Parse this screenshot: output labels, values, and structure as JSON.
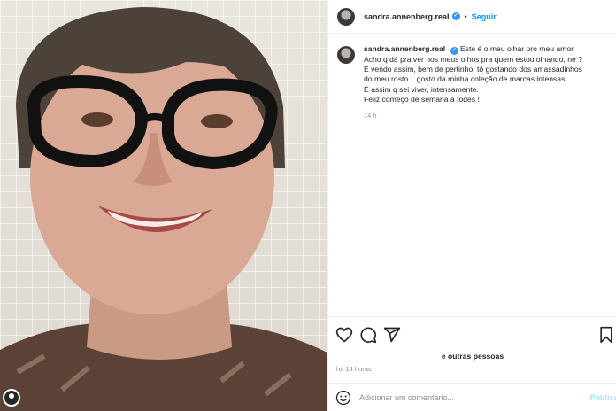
{
  "post": {
    "username": "sandra.annenberg.real",
    "follow_label": "Seguir",
    "separator": "•",
    "verified_mark": "✓"
  },
  "caption": {
    "lines": [
      "Este é o meu olhar pro meu amor.",
      "Acho q dá pra ver nos meus olhos pra quem estou olhando, né ?",
      "E vendo assim, bem de pertinho, tô gostando dos amassadinhos",
      "do meu rosto... gosto da minha coleção de marcas intensas.",
      "É assim q sei viver, intensamente.",
      "Feliz começo de semana a todes !"
    ],
    "time": "14 h"
  },
  "actions": {
    "like_icon": "heart-icon",
    "comment_icon": "comment-icon",
    "share_icon": "share-icon",
    "save_icon": "bookmark-icon"
  },
  "likes_text": "e outras pessoas",
  "timestamp": "há 14 horas",
  "comment_box": {
    "placeholder": "Adicionar um comentário...",
    "publish_label": "Publicar"
  },
  "colors": {
    "link_blue": "#0095f6",
    "muted": "#8e8e8e",
    "publish_disabled": "#b2dffc"
  }
}
